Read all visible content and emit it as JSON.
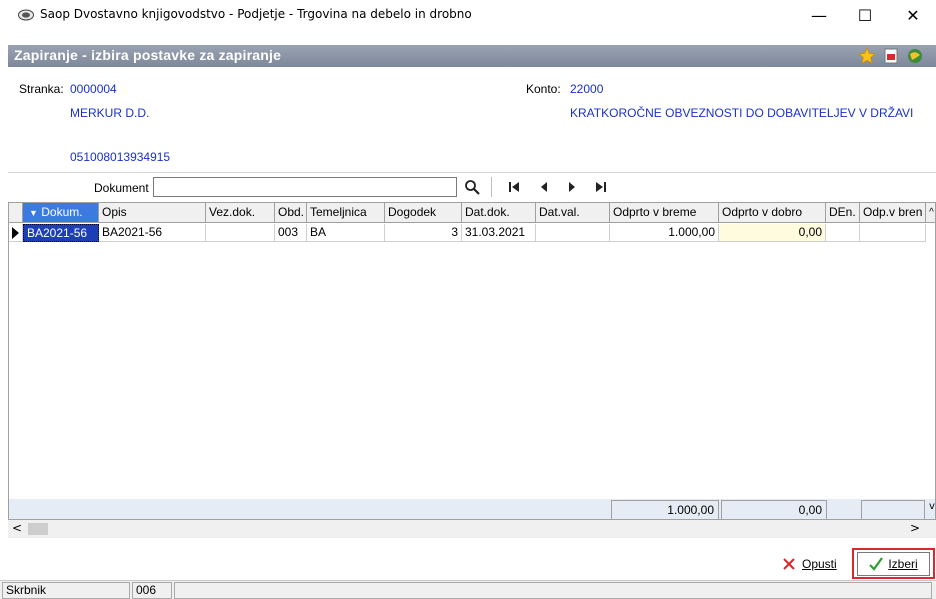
{
  "window": {
    "title": "Saop Dvostavno knjigovodstvo - Podjetje - Trgovina na debelo in drobno",
    "minimize": "—",
    "maximize": "☐",
    "close": "✕"
  },
  "header": {
    "title": "Zapiranje - izbira postavke za zapiranje"
  },
  "info": {
    "stranka_label": "Stranka:",
    "stranka_code": "0000004",
    "stranka_name": "MERKUR D.D.",
    "stranka_number": "051008013934915",
    "konto_label": "Konto:",
    "konto_code": "22000",
    "konto_name": "KRATKOROČNE OBVEZNOSTI DO DOBAVITELJEV V DRŽAVI"
  },
  "toolbar": {
    "dokument_label": "Dokument",
    "dokument_value": ""
  },
  "grid": {
    "columns": [
      "Dokum.",
      "Opis",
      "Vez.dok.",
      "Obd.",
      "Temeljnica",
      "Dogodek",
      "Dat.dok.",
      "Dat.val.",
      "Odprto v breme",
      "Odprto v dobro",
      "DEn.",
      "Odp.v bren"
    ],
    "rows": [
      {
        "dokum": "BA2021-56",
        "opis": "BA2021-56",
        "vez_dok": "",
        "obd": "003",
        "temeljnica": "BA",
        "dogodek": "3",
        "dat_dok": "31.03.2021",
        "dat_val": "",
        "breme": "1.000,00",
        "dobro": "0,00",
        "den": "",
        "odp": ""
      }
    ],
    "totals": {
      "breme": "1.000,00",
      "dobro": "0,00"
    }
  },
  "buttons": {
    "cancel": "Opusti",
    "ok": "Izberi"
  },
  "status": {
    "user": "Skrbnik",
    "code": "006"
  },
  "colors": {
    "band": "#8b94a5",
    "link_blue": "#1a31c8",
    "selected_cell": "#1c3fb3",
    "highlight_cell": "#fffbdf",
    "ok_border": "#d9282f"
  }
}
